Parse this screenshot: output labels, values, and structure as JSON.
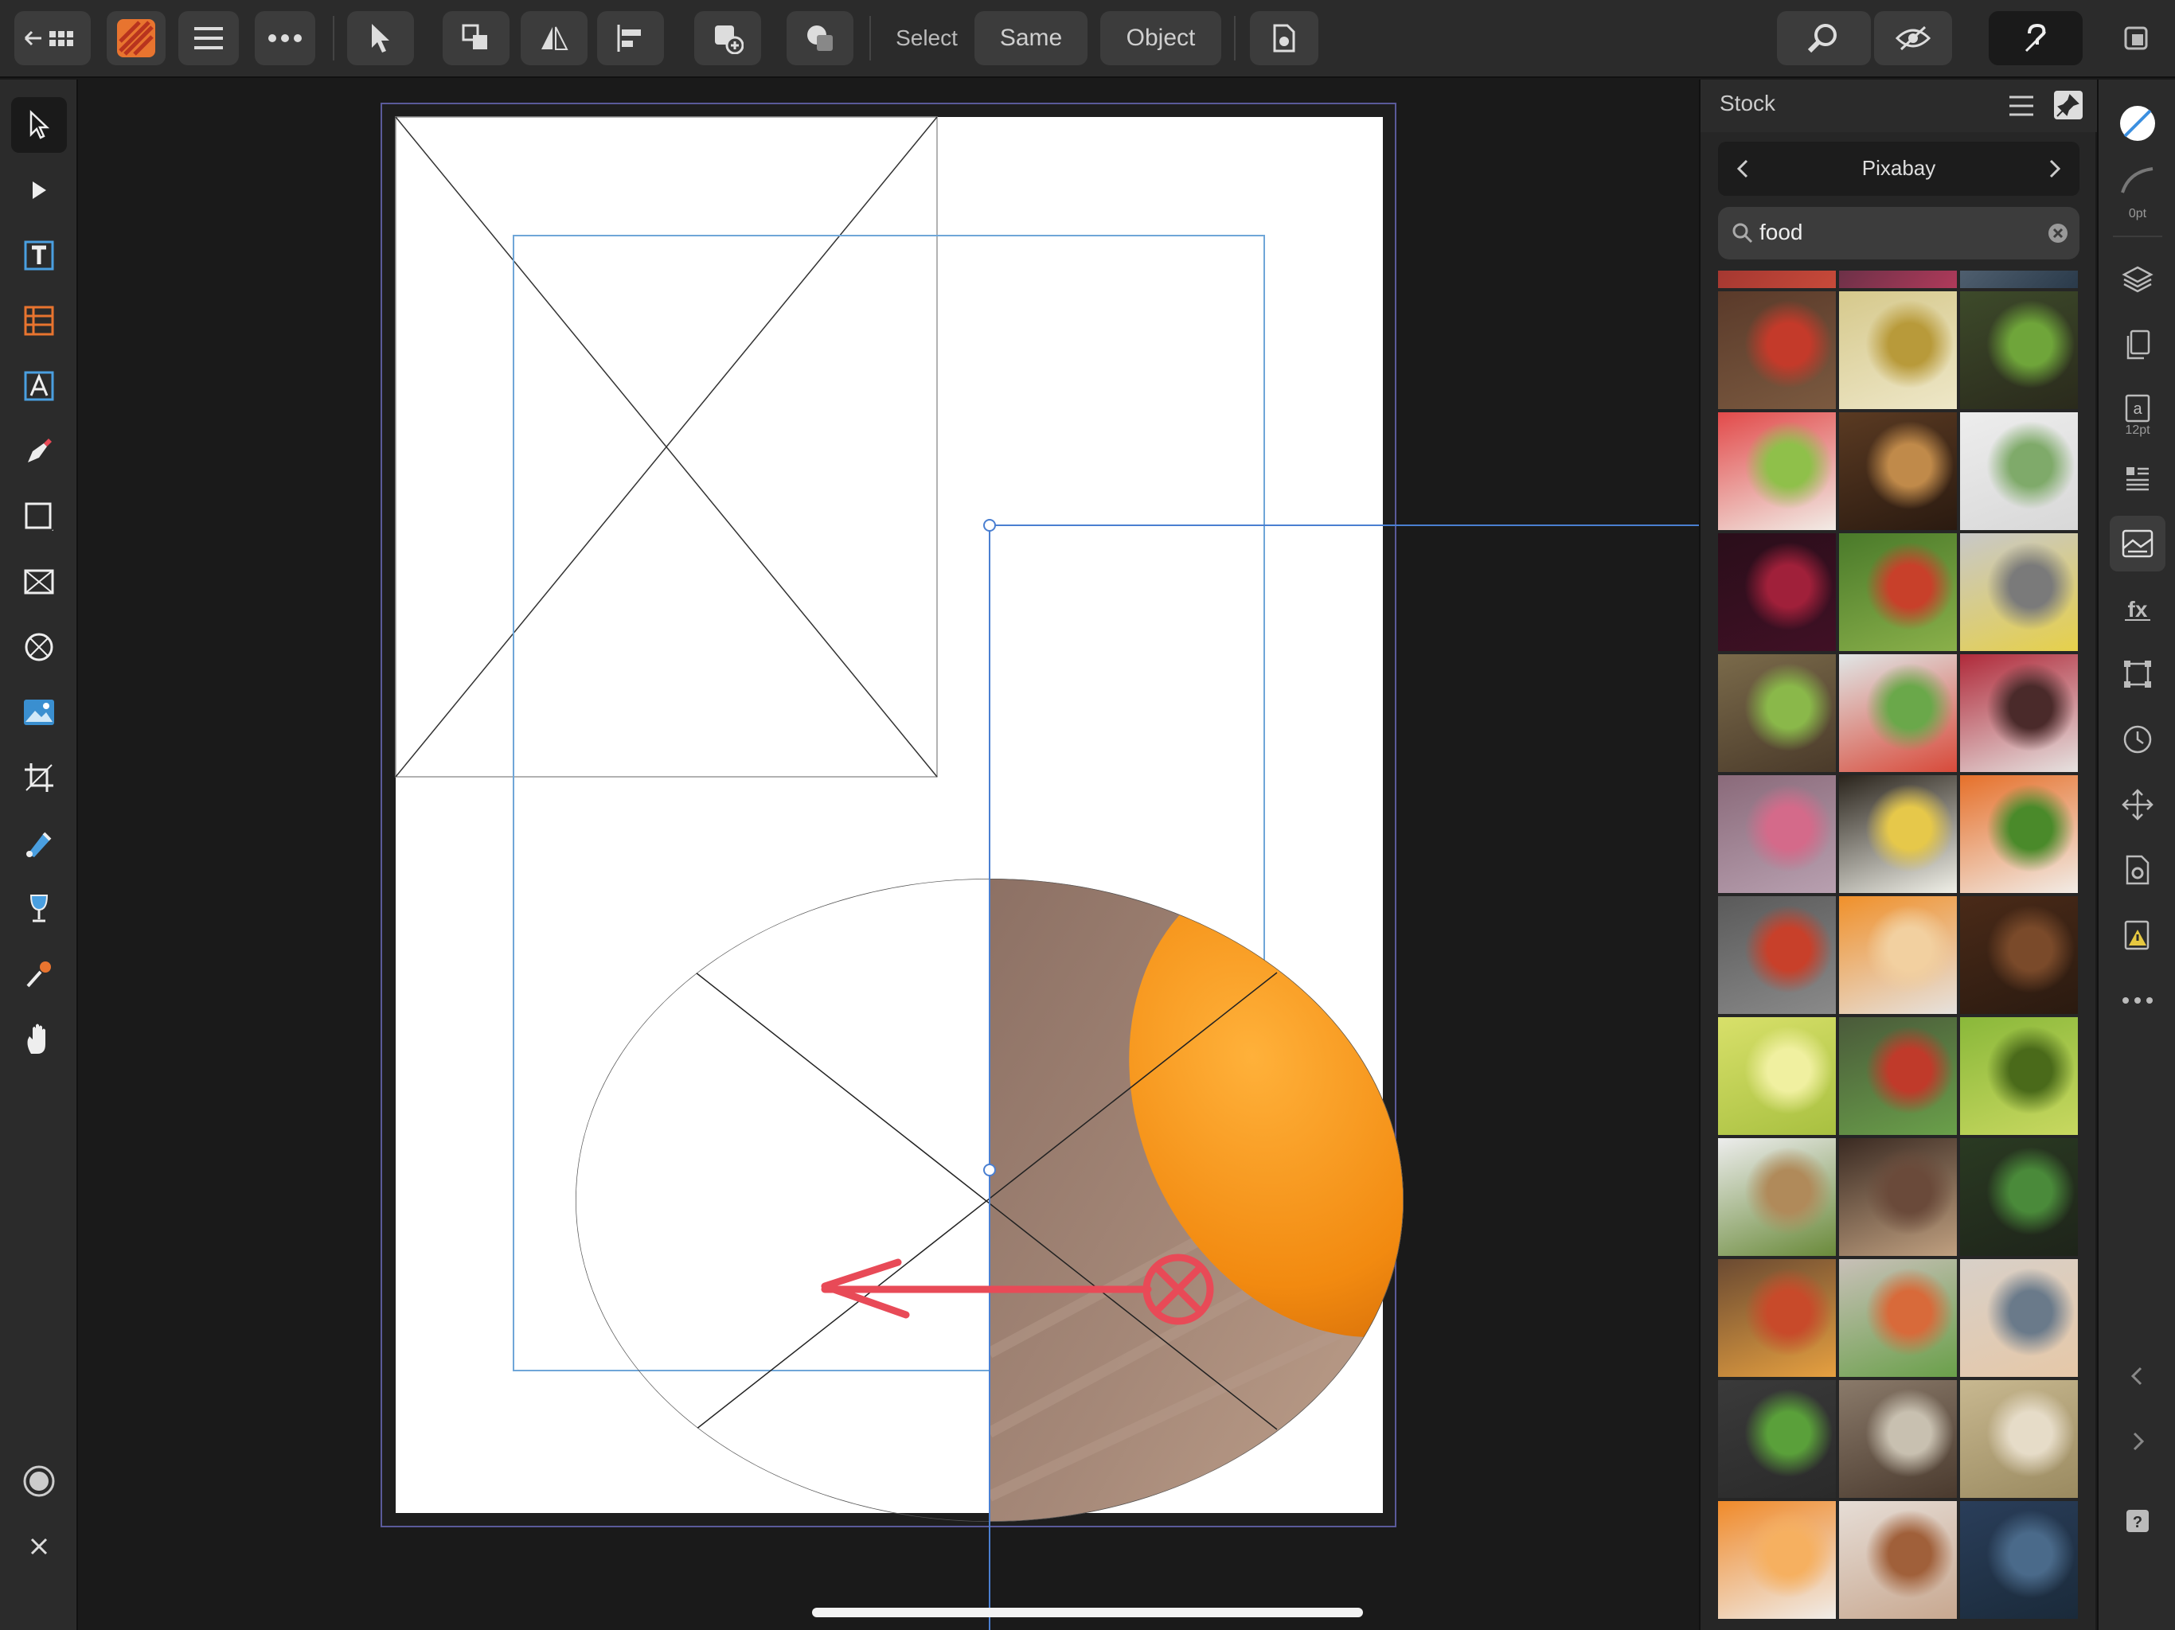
{
  "toolbar": {
    "select_label": "Select",
    "same_label": "Same",
    "object_label": "Object"
  },
  "stock": {
    "title": "Stock",
    "provider": "Pixabay",
    "search_value": "food"
  },
  "studio": {
    "stroke_width": "0pt",
    "text_size": "12pt"
  },
  "colors": {
    "accent_orange": "#e8742f",
    "selection_blue": "#4a7fd1",
    "gesture_red": "#e84a57"
  },
  "thumbnails": [
    {
      "name": "tomatoes-on-wood",
      "colors": [
        "#5a3a2a",
        "#c43a2a",
        "#7b5a40"
      ]
    },
    {
      "name": "olive-oil-bowl",
      "colors": [
        "#d6c98c",
        "#b89a3a",
        "#eee7c8"
      ]
    },
    {
      "name": "vegetables-basket",
      "colors": [
        "#3d4a2a",
        "#6fa53a",
        "#2a2a1c"
      ]
    },
    {
      "name": "watermelon-hearts",
      "colors": [
        "#e24a4a",
        "#8fc04a",
        "#f2ece6"
      ]
    },
    {
      "name": "spices-star-anise",
      "colors": [
        "#5a3a22",
        "#c08a4a",
        "#2a1a10"
      ]
    },
    {
      "name": "herb-circle",
      "colors": [
        "#ededed",
        "#7faa6a",
        "#d8d8d8"
      ]
    },
    {
      "name": "night-street",
      "colors": [
        "#2a0e1a",
        "#a0203a",
        "#401025"
      ]
    },
    {
      "name": "apple-orchard",
      "colors": [
        "#4a7a2a",
        "#c8402a",
        "#8ab04a"
      ]
    },
    {
      "name": "man-with-banana",
      "colors": [
        "#c8c8c8",
        "#7a7a7a",
        "#e6d04a"
      ]
    },
    {
      "name": "salad-bowls",
      "colors": [
        "#7a6a4a",
        "#8ab84a",
        "#4a3a2a"
      ]
    },
    {
      "name": "cucumber-splash",
      "colors": [
        "#e0e6e6",
        "#6aa84a",
        "#d84a3a"
      ]
    },
    {
      "name": "raspberries-bowl",
      "colors": [
        "#b02a3a",
        "#4a2a2a",
        "#e6e2e0"
      ]
    },
    {
      "name": "macarons-pink",
      "colors": [
        "#8a6a7a",
        "#d46a8a",
        "#b8a0b0"
      ]
    },
    {
      "name": "eggs-dark",
      "colors": [
        "#2a241c",
        "#e6c84a",
        "#f0f0e8"
      ]
    },
    {
      "name": "carrots",
      "colors": [
        "#e6702a",
        "#4a8a2a",
        "#f2ece6"
      ]
    },
    {
      "name": "apple-books",
      "colors": [
        "#5a5a5a",
        "#c8402a",
        "#8a8a8a"
      ]
    },
    {
      "name": "orange-slices",
      "colors": [
        "#f0902a",
        "#f2d0a0",
        "#e6e2de"
      ]
    },
    {
      "name": "coffee-beans",
      "colors": [
        "#4a2a18",
        "#7a4a2a",
        "#2a1a10"
      ]
    },
    {
      "name": "lime-slices",
      "colors": [
        "#d8e06a",
        "#f0f0a0",
        "#a8c040"
      ]
    },
    {
      "name": "vegetables-mix",
      "colors": [
        "#4a5a3a",
        "#c03a2a",
        "#6aa04a"
      ]
    },
    {
      "name": "pears",
      "colors": [
        "#8ab83a",
        "#4a6a1a",
        "#c8d860"
      ]
    },
    {
      "name": "spices-white",
      "colors": [
        "#ededed",
        "#b08a5a",
        "#6a8a3a"
      ]
    },
    {
      "name": "kitchen-table",
      "colors": [
        "#3a2a22",
        "#6a4a3a",
        "#c0a080"
      ]
    },
    {
      "name": "spinach-bowl",
      "colors": [
        "#2a3a22",
        "#4a8a3a",
        "#1e241a"
      ]
    },
    {
      "name": "vegetables-wood",
      "colors": [
        "#6a4a32",
        "#c84a2a",
        "#e6a040"
      ]
    },
    {
      "name": "salmon-plate",
      "colors": [
        "#c8c0b8",
        "#d86a3a",
        "#6aa04a"
      ]
    },
    {
      "name": "couple-cooking",
      "colors": [
        "#d8d0c8",
        "#6a7a8a",
        "#e6c8a8"
      ]
    },
    {
      "name": "herbs-brick",
      "colors": [
        "#3a3a3a",
        "#5aa03a",
        "#2a2a2a"
      ]
    },
    {
      "name": "kitchen-window",
      "colors": [
        "#8a7a6a",
        "#c8c0b0",
        "#4a3a2e"
      ]
    },
    {
      "name": "wheat-field",
      "colors": [
        "#c8b890",
        "#e6dcc8",
        "#9a8a60"
      ]
    },
    {
      "name": "tangerine-peeled",
      "colors": [
        "#f08a2a",
        "#f6b060",
        "#f0ece8"
      ]
    },
    {
      "name": "coffee-cup",
      "colors": [
        "#e6ddd6",
        "#a0603a",
        "#c8a890"
      ]
    },
    {
      "name": "salt-heart",
      "colors": [
        "#2a3e5a",
        "#4a6a8a",
        "#1a2a3a"
      ]
    }
  ]
}
